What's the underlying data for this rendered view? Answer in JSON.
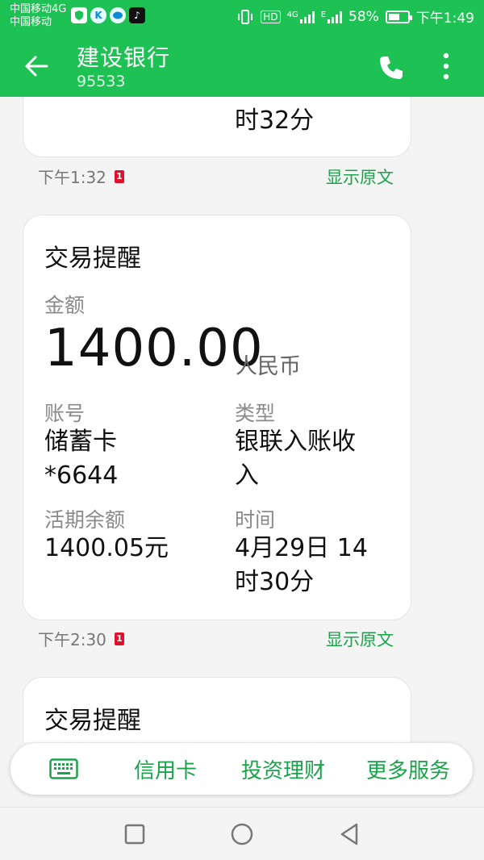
{
  "status": {
    "carrier1": "中国移动4G",
    "carrier2": "中国移动",
    "icons": [
      "shield-icon",
      "k-app-icon",
      "chat-app-icon",
      "tiktok-icon"
    ],
    "hd": "HD",
    "net1": "4G",
    "net2": "E",
    "battery": "58%",
    "battery_level": 0.58,
    "time": "下午1:49"
  },
  "header": {
    "title": "建设银行",
    "number": "95533"
  },
  "messages": [
    {
      "partial_top_text": "时32分",
      "time": "下午1:32",
      "sim": "1",
      "show_original": "显示原文"
    },
    {
      "title": "交易提醒",
      "amount_label": "金额",
      "amount": "1400.00",
      "currency": "人民币",
      "account_label": "账号",
      "account_line1": "储蓄卡",
      "account_line2": "*6644",
      "type_label": "类型",
      "type_line1": "银联入账收",
      "type_line2": "入",
      "balance_label": "活期余额",
      "balance": "1400.05元",
      "time_label": "时间",
      "time_line1": "4月29日 14",
      "time_line2": "时30分",
      "time": "下午2:30",
      "sim": "1",
      "show_original": "显示原文"
    },
    {
      "title": "交易提醒"
    }
  ],
  "menu": {
    "items": [
      "信用卡",
      "投资理财",
      "更多服务"
    ]
  },
  "colors": {
    "brand_green": "#1ec254",
    "link_green": "#1aa34a",
    "sim_red": "#e0112d"
  }
}
